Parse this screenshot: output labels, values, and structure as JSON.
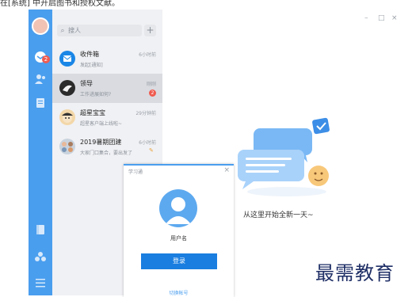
{
  "top_text": "在[系统] 中开启图书和授权文献。",
  "sidebar": {
    "badge": "2"
  },
  "search": {
    "placeholder": "搜人"
  },
  "conversations": [
    {
      "name": "收件箱",
      "message": "发起[通知]",
      "time": "6小时前",
      "unread": ""
    },
    {
      "name": "领导",
      "message": "工作进展如何?",
      "time": "刚刚",
      "unread": "2"
    },
    {
      "name": "超星宝宝",
      "message": "超星客户端上线啦~",
      "time": "29分钟前",
      "unread": ""
    },
    {
      "name": "2019暑期团建",
      "message": "大家门口集合，要出发了",
      "time": "6小时前",
      "unread": ""
    }
  ],
  "main": {
    "welcome": "从这里开始全新一天~"
  },
  "dialog": {
    "title": "学习通",
    "close": "×",
    "username": "用户名",
    "login_label": "登录",
    "switch_label": "切换帐号"
  },
  "window_controls": {
    "min": "–",
    "max": "□",
    "close": "×"
  },
  "watermark": "最需教育",
  "colors": {
    "sidebar": "#4a9eee",
    "accent": "#1a7ee0",
    "badge": "#f05b4f"
  }
}
